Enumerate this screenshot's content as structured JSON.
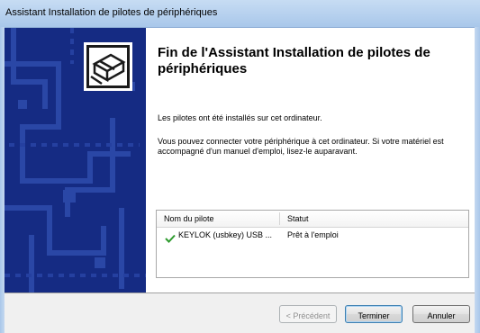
{
  "window": {
    "title": "Assistant Installation de pilotes de périphériques"
  },
  "side_panel": {
    "icon": "hardware-device-icon",
    "color": "#152b83"
  },
  "main": {
    "title": "Fin de l'Assistant Installation de pilotes de périphériques",
    "paragraph1": "Les pilotes ont été installés sur cet ordinateur.",
    "paragraph2": "Vous pouvez connecter votre périphérique à cet ordinateur. Si votre matériel est accompagné d'un manuel d'emploi, lisez-le auparavant."
  },
  "driver_list": {
    "columns": [
      "Nom du pilote",
      "Statut"
    ],
    "rows": [
      {
        "status_icon": "green-check-icon",
        "name": "KEYLOK (usbkey) USB ...",
        "status": "Prêt à l'emploi"
      }
    ]
  },
  "buttons": {
    "previous": "< Précédent",
    "finish": "Terminer",
    "cancel": "Annuler"
  }
}
